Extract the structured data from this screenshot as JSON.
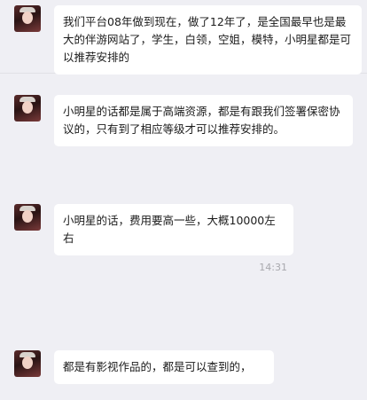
{
  "messages": [
    {
      "text": "我们平台08年做到现在，做了12年了，是全国最早也是最大的伴游网站了，学生，白领，空姐，模特，小明星都是可以推荐安排的"
    },
    {
      "text": "小明星的话都是属于高端资源，都是有跟我们签署保密协议的，只有到了相应等级才可以推荐安排的。"
    },
    {
      "text": "小明星的话，费用要高一些，大概10000左右"
    },
    {
      "text": "都是有影视作品的，都是可以查到的，"
    }
  ],
  "timestamp": "14:31",
  "colors": {
    "background": "#efeff4",
    "bubble": "#ffffff",
    "text": "#1b1b1b",
    "timestamp": "#a8a8ad"
  }
}
